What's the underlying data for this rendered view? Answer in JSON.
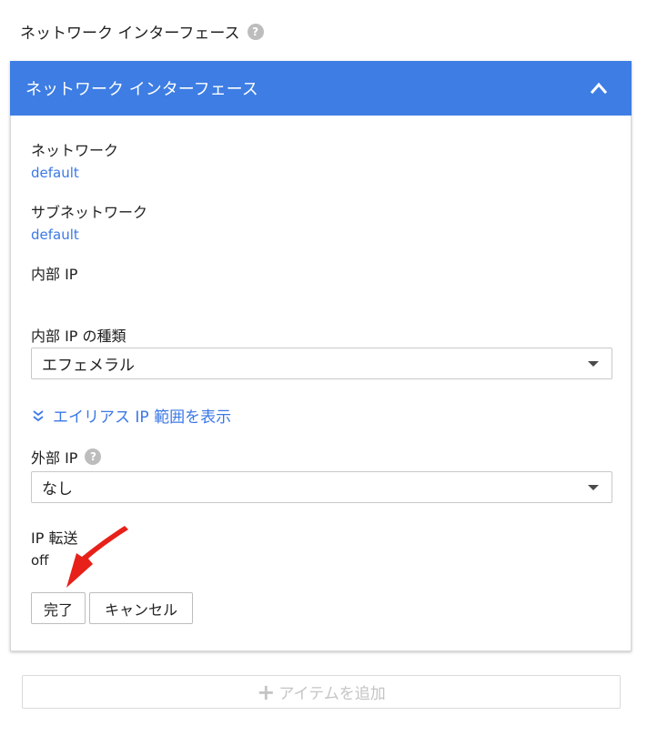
{
  "section": {
    "title": "ネットワーク インターフェース",
    "help_icon": "?"
  },
  "card": {
    "header_title": "ネットワーク インターフェース",
    "collapse_icon": "chevron-up-icon",
    "header_color": "#3d7de4",
    "network": {
      "label": "ネットワーク",
      "value": "default"
    },
    "subnetwork": {
      "label": "サブネットワーク",
      "value": "default"
    },
    "internal_ip": {
      "label": "内部 IP"
    },
    "internal_ip_type": {
      "label": "内部 IP の種類",
      "selected": "エフェメラル"
    },
    "alias_link": "エイリアス IP 範囲を表示",
    "external_ip": {
      "label": "外部 IP",
      "help_icon": "?",
      "selected": "なし"
    },
    "ip_forwarding": {
      "label": "IP 転送",
      "value": "off"
    },
    "buttons": {
      "done": "完了",
      "cancel": "キャンセル"
    }
  },
  "add_item": {
    "icon": "+",
    "label": "アイテムを追加"
  },
  "colors": {
    "link": "#3b78e7",
    "annotation_arrow": "#e8201a"
  }
}
